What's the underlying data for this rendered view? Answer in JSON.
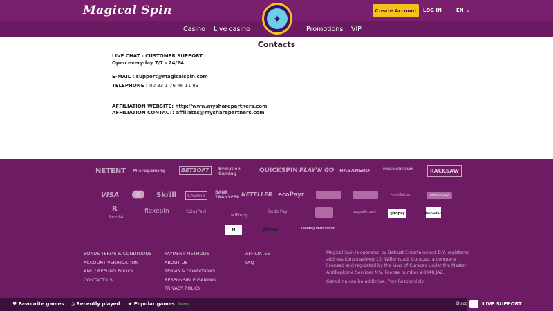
{
  "header": {
    "logo": "Magical Spin",
    "create_account": "Create Account",
    "login": "LOG IN",
    "language": "EN"
  },
  "nav": [
    "Casino",
    "Live casino",
    "Promotions",
    "VIP"
  ],
  "page": {
    "title": "Contacts",
    "live_chat_heading": "LIVE CHAT - CUSTOMER SUPPORT :",
    "live_chat_hours": "Open everyday 7/7 - 24/24",
    "email_label": "E-MAIL : support@magicalspin.com",
    "telephone_label": "TELEPHONE : ",
    "telephone_value": "00 33 1 76 46 11 83",
    "affiliation_website_label": "AFFILIATION WEBSITE: ",
    "affiliation_website_url": "http://www.mysharepartners.com",
    "affiliation_contact": "AFFILIATION CONTACT: affiliates@mysharepartners.com"
  },
  "providers": [
    "NETENT",
    "Microgaming",
    "BETSOFT",
    "Evolution Gaming",
    "QUICKSPIN",
    "PLAY'N GO",
    "HABANERO",
    "PRAGMATIC PLAY",
    "RACKSAW"
  ],
  "payments_row1": [
    "VISA",
    "Skrill",
    "CASHlib",
    "BANK TRANSFER",
    "NETELLER",
    "ecoPayz",
    "MuchBetter",
    "Mobile Pay"
  ],
  "payments_row2": [
    "Revolut",
    "flexepin",
    "CoinsPaid",
    "MiFinity",
    "Rodo Pay",
    "paysafecard",
    "giropay",
    "Bancontact"
  ],
  "payments_row3": [
    "Identity Verification"
  ],
  "footer_links": {
    "col1": [
      "BONUS TERMS & CONDITIONS",
      "ACCOUNT VERIFICATION",
      "AML / REFUND POLICY",
      "CONTACT US"
    ],
    "col2": [
      "PAYMENT METHODS",
      "ABOUT US",
      "TERMS & CONDITIONS",
      "RESPONSIBLE GAMING",
      "PRIVACY POLICY"
    ],
    "col3": [
      "AFFILIATES",
      "FAQ"
    ]
  },
  "legal": {
    "text": "Magical Spin is operated by Betrust Entertainment B.V. registered address Korporaalweg 10, Willemstad, Curaçao, a company licensed and regulated by the laws of Curacao under the Master Antillephone Services N.V. license number #8048/JAZ.",
    "warning": "Gambling can be addictive. Play Responsibly."
  },
  "bottom_bar": {
    "favourite": "Favourite games",
    "recent": "Recently played",
    "popular": "Popular games",
    "news": "News",
    "disco": "Disco",
    "live_support": "LIVE SUPPORT"
  },
  "colors": {
    "header_bg": "#7a1f6e",
    "nav_bg": "#6a1a61",
    "footer_bg": "#6d1b63",
    "bottom_bar_bg": "#3d0f3b",
    "accent": "#f4c21c"
  }
}
